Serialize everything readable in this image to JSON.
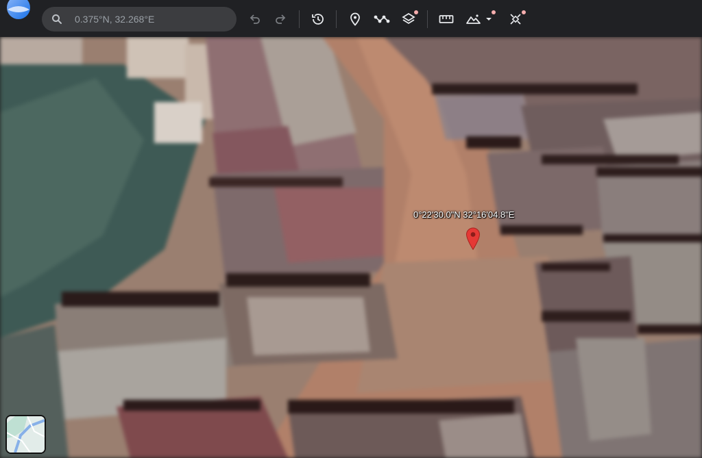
{
  "app": {
    "logo_icon": "google-earth-logo-icon"
  },
  "search": {
    "icon": "search-icon",
    "value": "0.375°N, 32.268°E"
  },
  "toolbar": {
    "buttons": [
      {
        "id": "undo",
        "icon": "undo-icon"
      },
      {
        "id": "redo",
        "icon": "redo-icon"
      },
      {
        "id": "history",
        "icon": "historical-imagery-icon"
      },
      {
        "id": "placemark",
        "icon": "add-placemark-icon"
      },
      {
        "id": "path",
        "icon": "draw-path-icon"
      },
      {
        "id": "layers",
        "icon": "map-style-layers-icon",
        "has_dot": true
      },
      {
        "id": "measure",
        "icon": "measure-ruler-icon"
      },
      {
        "id": "projects",
        "icon": "projects-dropdown-icon",
        "has_dot": true
      },
      {
        "id": "settings",
        "icon": "tools-icon",
        "has_dot": true
      }
    ],
    "dot_color": "#f6aeae"
  },
  "map": {
    "marker_label": "0°22'30.0\"N 32°16'04.8\"E",
    "marker_icon": "location-pin-icon",
    "marker_color": "#e53935",
    "minimap_icon": "minimap-thumbnail-icon"
  }
}
